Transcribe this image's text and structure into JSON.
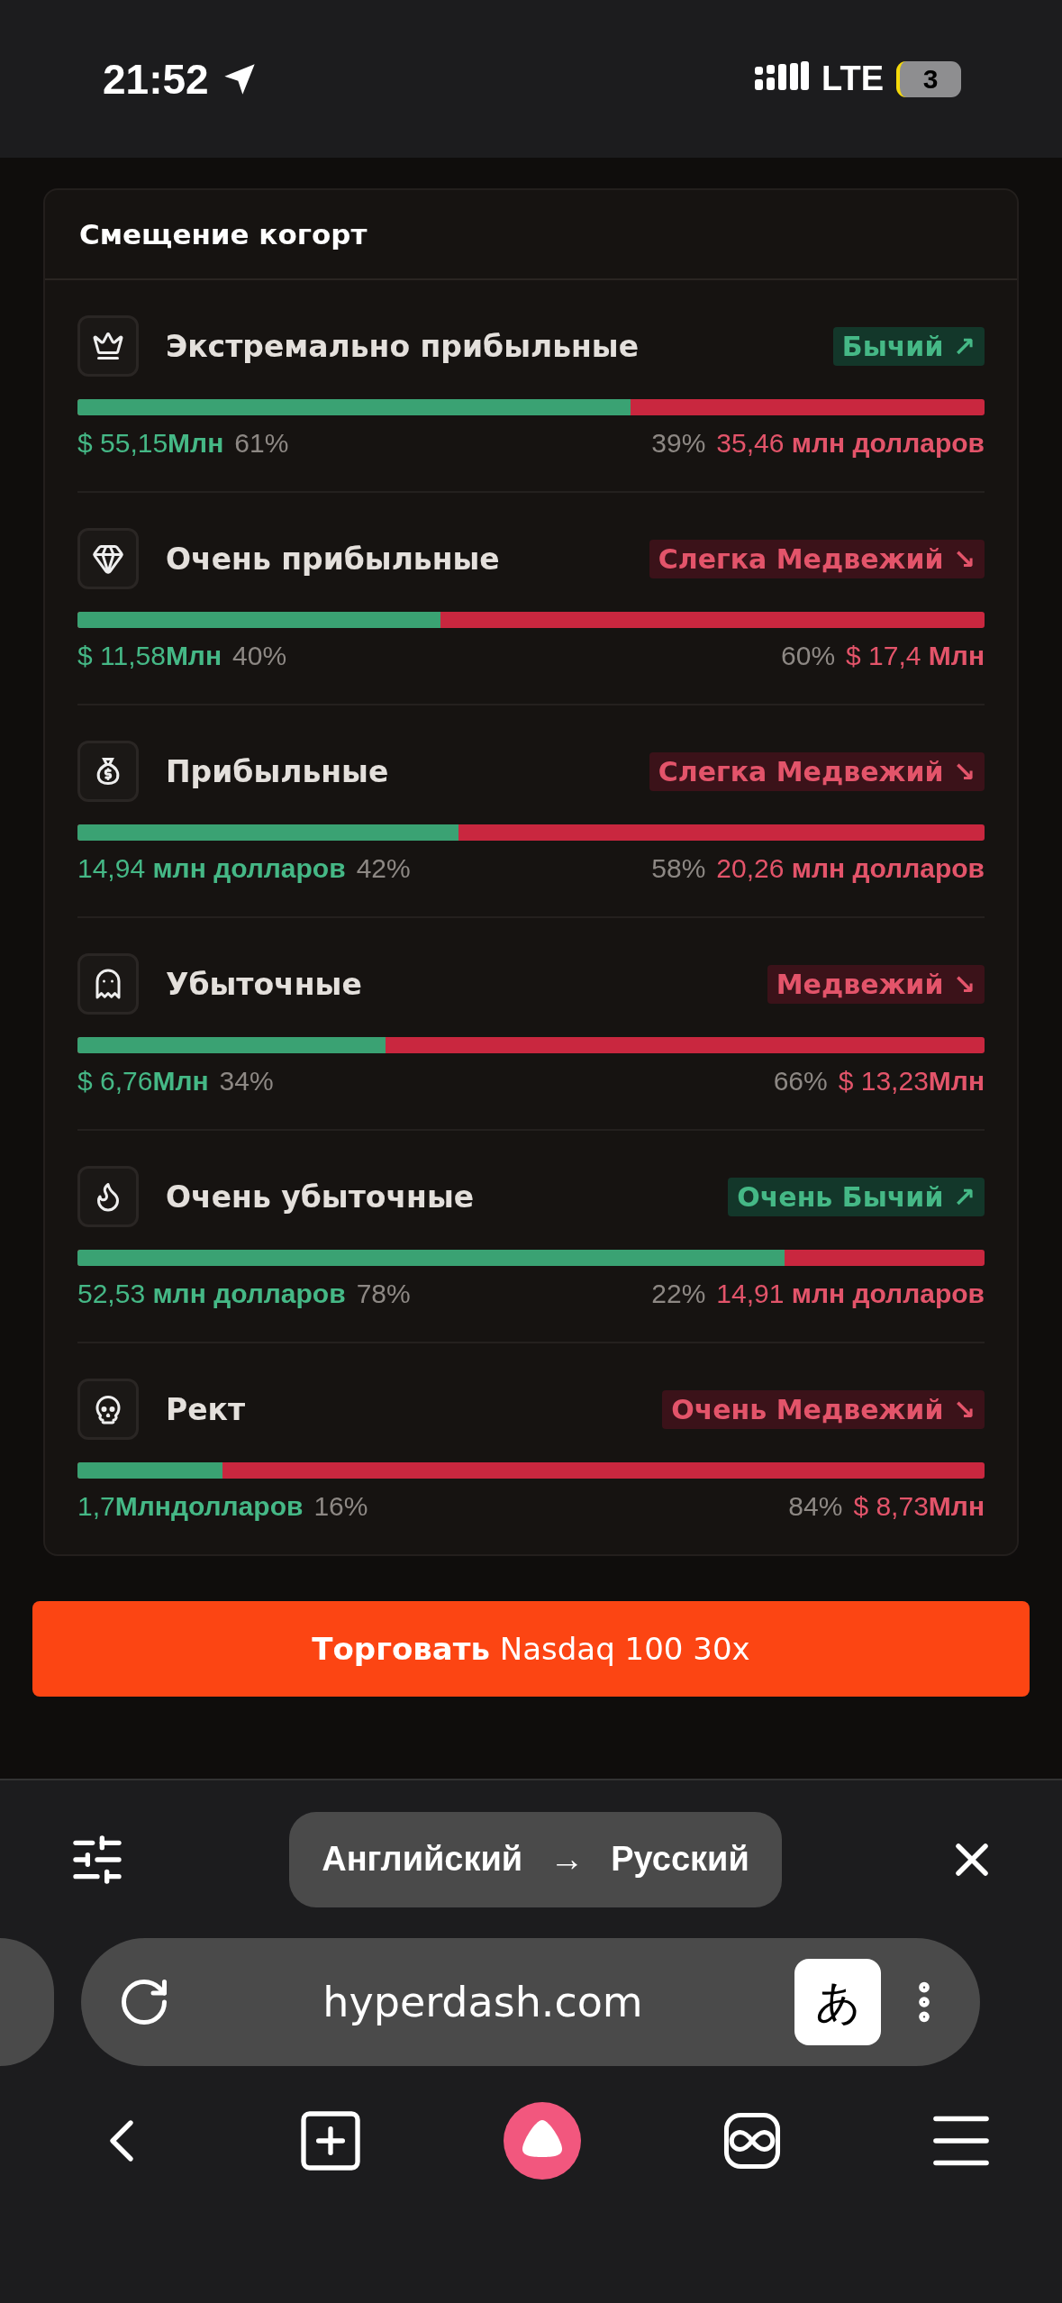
{
  "status_bar": {
    "time": "21:52",
    "network": "LTE",
    "battery": "3"
  },
  "cohort_card": {
    "title": "Смещение когорт",
    "rows": [
      {
        "name": "Экстремально прибыльные",
        "kind": "bullish",
        "badge": "Бычий ↗",
        "level": 0.61,
        "long_value": "$ 55,15**Млн**",
        "long_pct": "61%",
        "short_pct": "39%",
        "short_value": "35,46 **млн долларов**"
      },
      {
        "name": "Очень прибыльные",
        "kind": "bearish",
        "badge": "Слегка Медвежий ↘",
        "level": 0.4,
        "long_value": "$ 11,58**Млн**",
        "long_pct": "40%",
        "short_pct": "60%",
        "short_value": "$ 17,4 **Млн**"
      },
      {
        "name": "Прибыльные",
        "kind": "bearish",
        "badge": "Слегка Медвежий ↘",
        "level": 0.42,
        "long_value": "14,94 **млн долларов**",
        "long_pct": "42%",
        "short_pct": "58%",
        "short_value": "20,26 **млн долларов**"
      },
      {
        "name": "Убыточные",
        "kind": "bearish",
        "badge": "Медвежий ↘",
        "level": 0.34,
        "long_value": "$ 6,76**Млн**",
        "long_pct": "34%",
        "short_pct": "66%",
        "short_value": "$ 13,23**Млн**"
      },
      {
        "name": "Очень убыточные",
        "kind": "bullish",
        "badge": "Очень Бычий ↗",
        "level": 0.78,
        "long_value": "52,53 **млн долларов**",
        "long_pct": "78%",
        "short_pct": "22%",
        "short_value": "14,91 **млн долларов**"
      },
      {
        "name": "Рект",
        "kind": "bearish",
        "badge": "Очень Медвежий ↘",
        "level": 0.16,
        "long_value": "1,7**Млндолларов**",
        "long_pct": "16%",
        "short_pct": "84%",
        "short_value": "$ 8,73**Млн**"
      }
    ]
  },
  "trade_button": {
    "label": "**Торговать** Nasdaq 100 30x"
  },
  "translate_bar": {
    "from": "Английский",
    "arrow": "→",
    "to": "Русский"
  },
  "address_bar": {
    "url": "hyperdash.com",
    "translate_glyph": "あ"
  }
}
